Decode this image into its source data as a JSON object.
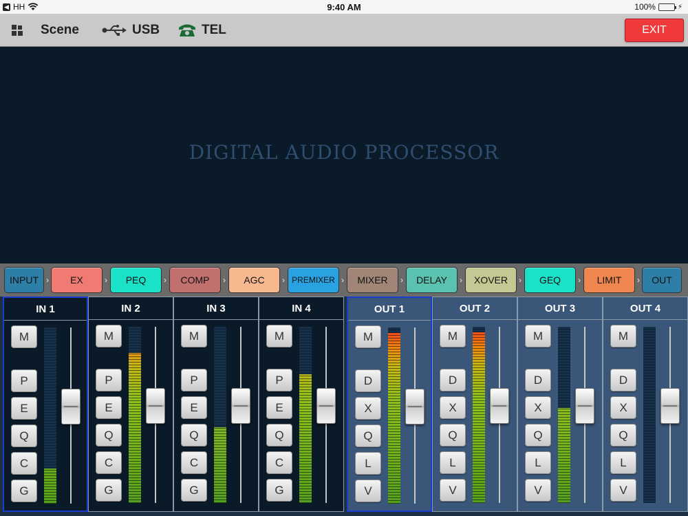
{
  "status_bar": {
    "carrier": "HH",
    "time": "9:40 AM",
    "battery": "100%"
  },
  "toolbar": {
    "scene_label": "Scene",
    "usb_label": "USB",
    "tel_label": "TEL",
    "exit_label": "EXIT"
  },
  "display": {
    "title": "DIGITAL AUDIO PROCESSOR"
  },
  "chain": {
    "modules": [
      {
        "label": "INPUT",
        "color": "#2e7fa8"
      },
      {
        "label": "EX",
        "color": "#ef7b73"
      },
      {
        "label": "PEQ",
        "color": "#19e2c9"
      },
      {
        "label": "COMP",
        "color": "#c2706f"
      },
      {
        "label": "AGC",
        "color": "#f8b88f"
      },
      {
        "label": "PREMIXER",
        "color": "#2aa2e2"
      },
      {
        "label": "MIXER",
        "color": "#a18677"
      },
      {
        "label": "DELAY",
        "color": "#5cc2b0"
      },
      {
        "label": "XOVER",
        "color": "#c4c994"
      },
      {
        "label": "GEQ",
        "color": "#19e2c9"
      },
      {
        "label": "LIMIT",
        "color": "#f0864f"
      },
      {
        "label": "OUT",
        "color": "#2e7fa8"
      }
    ]
  },
  "inputs": [
    {
      "name": "IN 1",
      "mute": "M",
      "buttons": [
        "P",
        "E",
        "Q",
        "C",
        "G"
      ],
      "level": 0.2,
      "fader": 0.55
    },
    {
      "name": "IN 2",
      "mute": "M",
      "buttons": [
        "P",
        "E",
        "Q",
        "C",
        "G"
      ],
      "level": 0.85,
      "fader": 0.55
    },
    {
      "name": "IN 3",
      "mute": "M",
      "buttons": [
        "P",
        "E",
        "Q",
        "C",
        "G"
      ],
      "level": 0.43,
      "fader": 0.55
    },
    {
      "name": "IN 4",
      "mute": "M",
      "buttons": [
        "P",
        "E",
        "Q",
        "C",
        "G"
      ],
      "level": 0.73,
      "fader": 0.55
    }
  ],
  "outputs": [
    {
      "name": "OUT 1",
      "mute": "M",
      "buttons": [
        "D",
        "X",
        "Q",
        "L",
        "V"
      ],
      "level": 0.97,
      "fader": 0.55
    },
    {
      "name": "OUT 2",
      "mute": "M",
      "buttons": [
        "D",
        "X",
        "Q",
        "L",
        "V"
      ],
      "level": 0.97,
      "fader": 0.55
    },
    {
      "name": "OUT 3",
      "mute": "M",
      "buttons": [
        "D",
        "X",
        "Q",
        "L",
        "V"
      ],
      "level": 0.54,
      "fader": 0.55
    },
    {
      "name": "OUT 4",
      "mute": "M",
      "buttons": [
        "D",
        "X",
        "Q",
        "L",
        "V"
      ],
      "level": 0.0,
      "fader": 0.55
    }
  ]
}
